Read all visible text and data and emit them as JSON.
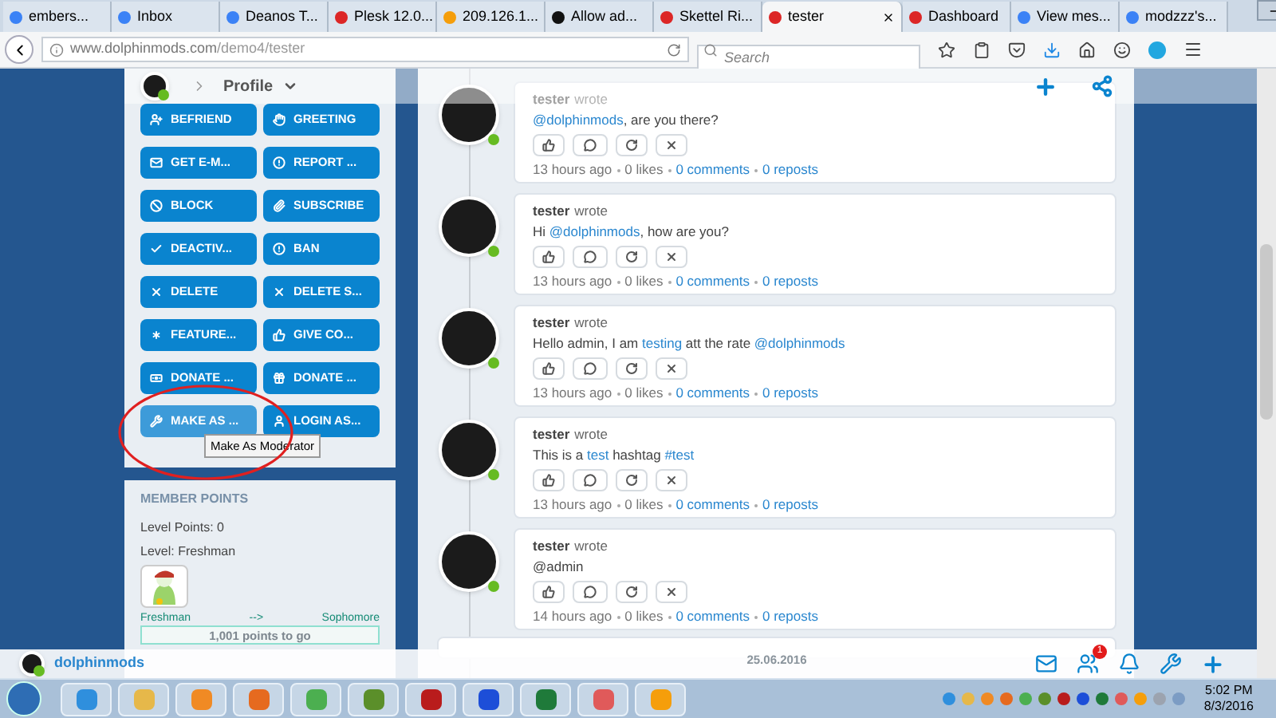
{
  "browser": {
    "tabs": [
      {
        "label": "embers...",
        "selected": false
      },
      {
        "label": "Inbox",
        "selected": false
      },
      {
        "label": "Deanos T...",
        "selected": false
      },
      {
        "label": "Plesk 12.0...",
        "selected": false
      },
      {
        "label": "209.126.1...",
        "selected": false
      },
      {
        "label": "Allow ad...",
        "selected": false
      },
      {
        "label": "Skettel Ri...",
        "selected": false
      },
      {
        "label": "tester",
        "selected": true
      },
      {
        "label": "Dashboard",
        "selected": false
      },
      {
        "label": "View mes...",
        "selected": false
      },
      {
        "label": "modzzz's...",
        "selected": false
      }
    ],
    "url_host": "www.dolphinmods.com",
    "url_path": "/demo4/tester",
    "search": {
      "placeholder": "Search"
    }
  },
  "profile_header": {
    "title": "Profile"
  },
  "actions": [
    {
      "label": "BEFRIEND",
      "hovered": false
    },
    {
      "label": "GREETING",
      "hovered": false
    },
    {
      "label": "GET E-M...",
      "hovered": false
    },
    {
      "label": "REPORT ...",
      "hovered": false
    },
    {
      "label": "BLOCK",
      "hovered": false
    },
    {
      "label": "SUBSCRIBE",
      "hovered": false
    },
    {
      "label": "DEACTIV...",
      "hovered": false
    },
    {
      "label": "BAN",
      "hovered": false
    },
    {
      "label": "DELETE",
      "hovered": false
    },
    {
      "label": "DELETE S...",
      "hovered": false
    },
    {
      "label": "FEATURE...",
      "hovered": false
    },
    {
      "label": "GIVE CO...",
      "hovered": false
    },
    {
      "label": "DONATE ...",
      "hovered": false
    },
    {
      "label": "DONATE ...",
      "hovered": false
    },
    {
      "label": "MAKE AS ...",
      "hovered": true
    },
    {
      "label": "LOGIN AS...",
      "hovered": false
    }
  ],
  "tooltip": {
    "text": "Make As Moderator"
  },
  "member_points": {
    "heading": "MEMBER POINTS",
    "level_points": "Level Points: 0",
    "level": "Level: Freshman",
    "from": "Freshman",
    "arrow": "-->",
    "to": "Sophomore",
    "progress": {
      "text": "1,001 points to go",
      "level": 0
    }
  },
  "posts": [
    {
      "author": "tester",
      "verb": "wrote",
      "segments": [
        {
          "kind": "link",
          "text": "@dolphinmods"
        },
        {
          "kind": "plain",
          "text": ", are you there?"
        }
      ],
      "time": "13 hours ago",
      "likes": "0 likes",
      "comments": "0 comments",
      "reposts": "0 reposts"
    },
    {
      "author": "tester",
      "verb": "wrote",
      "segments": [
        {
          "kind": "plain",
          "text": "Hi "
        },
        {
          "kind": "link",
          "text": "@dolphinmods"
        },
        {
          "kind": "plain",
          "text": ", how are you?"
        }
      ],
      "time": "13 hours ago",
      "likes": "0 likes",
      "comments": "0 comments",
      "reposts": "0 reposts"
    },
    {
      "author": "tester",
      "verb": "wrote",
      "segments": [
        {
          "kind": "plain",
          "text": "Hello admin, I am "
        },
        {
          "kind": "link",
          "text": "testing"
        },
        {
          "kind": "plain",
          "text": " att the rate "
        },
        {
          "kind": "link",
          "text": "@dolphinmods"
        }
      ],
      "time": "13 hours ago",
      "likes": "0 likes",
      "comments": "0 comments",
      "reposts": "0 reposts"
    },
    {
      "author": "tester",
      "verb": "wrote",
      "segments": [
        {
          "kind": "plain",
          "text": "This is a "
        },
        {
          "kind": "link",
          "text": "test"
        },
        {
          "kind": "plain",
          "text": " hashtag "
        },
        {
          "kind": "link",
          "text": "#test"
        }
      ],
      "time": "13 hours ago",
      "likes": "0 likes",
      "comments": "0 comments",
      "reposts": "0 reposts"
    },
    {
      "author": "tester",
      "verb": "wrote",
      "segments": [
        {
          "kind": "plain",
          "text": "@admin"
        }
      ],
      "time": "14 hours ago",
      "likes": "0 likes",
      "comments": "0 comments",
      "reposts": "0 reposts"
    }
  ],
  "date_separator": "25.06.2016",
  "bottom_bar": {
    "username": "dolphinmods",
    "friends_badge": "1"
  },
  "taskbar": {
    "time": "5:02 PM",
    "date": "8/3/2016"
  }
}
